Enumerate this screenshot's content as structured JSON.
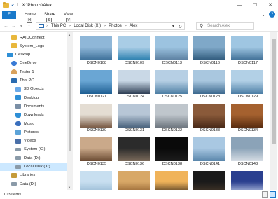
{
  "titlebar": {
    "title": "X:\\Photos\\Alex",
    "sep": "|",
    "minimize": "—",
    "maximize": "☐",
    "close": "✕"
  },
  "ribbon": {
    "file": "F",
    "tabs": [
      {
        "label": "Home",
        "keytip": "H"
      },
      {
        "label": "Share",
        "keytip": "S"
      },
      {
        "label": "View",
        "keytip": "V"
      }
    ],
    "help": "?"
  },
  "address": {
    "back": "←",
    "forward": "→",
    "recent": "▾",
    "up": "↑",
    "crumbs": [
      "This PC",
      "Local Disk (X:)",
      "Photos",
      "Alex"
    ],
    "crumb_sep": ">",
    "refresh": "↻",
    "dropdown": "▾"
  },
  "search": {
    "placeholder": "Search Alex"
  },
  "sidebar": {
    "items": [
      {
        "label": "RAIDConnect",
        "icon": "folder-icon",
        "indent": 2,
        "selected": false
      },
      {
        "label": "System_Logs",
        "icon": "folder-icon",
        "indent": 2,
        "selected": false
      },
      {
        "label": "Desktop",
        "icon": "desktop-icon",
        "indent": 1,
        "selected": false
      },
      {
        "label": "OneDrive",
        "icon": "onedrive-icon",
        "indent": 2,
        "selected": false
      },
      {
        "label": "Tester 1",
        "icon": "user-icon",
        "indent": 2,
        "selected": false
      },
      {
        "label": "This PC",
        "icon": "pc-icon",
        "indent": 2,
        "selected": false
      },
      {
        "label": "3D Objects",
        "icon": "cube-icon",
        "indent": 3,
        "selected": false
      },
      {
        "label": "Desktop",
        "icon": "desktop-icon",
        "indent": 3,
        "selected": false
      },
      {
        "label": "Documents",
        "icon": "documents-icon",
        "indent": 3,
        "selected": false
      },
      {
        "label": "Downloads",
        "icon": "downloads-icon",
        "indent": 3,
        "selected": false
      },
      {
        "label": "Music",
        "icon": "music-icon",
        "indent": 3,
        "selected": false
      },
      {
        "label": "Pictures",
        "icon": "pictures-icon",
        "indent": 3,
        "selected": false
      },
      {
        "label": "Videos",
        "icon": "videos-icon",
        "indent": 3,
        "selected": false
      },
      {
        "label": "System (C:)",
        "icon": "drive-icon",
        "indent": 3,
        "selected": false
      },
      {
        "label": "Data (D:)",
        "icon": "drive-icon",
        "indent": 3,
        "selected": false
      },
      {
        "label": "Local Disk (X:)",
        "icon": "drive-icon",
        "indent": 3,
        "selected": true
      },
      {
        "label": "Libraries",
        "icon": "libraries-icon",
        "indent": 2,
        "selected": false
      },
      {
        "label": "Data (D:)",
        "icon": "drive-icon",
        "indent": 2,
        "selected": false
      }
    ]
  },
  "files": [
    {
      "name": "DSCN0108",
      "top": "#8fb7d8",
      "bottom": "#3c6f98"
    },
    {
      "name": "DSCN0109",
      "top": "#a9cde6",
      "bottom": "#2a7fae"
    },
    {
      "name": "DSCN0113",
      "top": "#9cc3e0",
      "bottom": "#5b7fa0"
    },
    {
      "name": "DSCN0116",
      "top": "#7fa8c8",
      "bottom": "#2f5a7c"
    },
    {
      "name": "DSCN0117",
      "top": "#9fc6e2",
      "bottom": "#3f6f96"
    },
    {
      "name": "DSCN0121",
      "top": "#6aa6d4",
      "bottom": "#1f5f93"
    },
    {
      "name": "DSCN0124",
      "top": "#c9d8e6",
      "bottom": "#2f3f55"
    },
    {
      "name": "DSCN0125",
      "top": "#b6cfe4",
      "bottom": "#4e7fa4"
    },
    {
      "name": "DSCN0128",
      "top": "#a9c7df",
      "bottom": "#3d6a8f"
    },
    {
      "name": "DSCN0129",
      "top": "#b2d0e6",
      "bottom": "#4c7ea5"
    },
    {
      "name": "DSCN0130",
      "top": "#e4ddd3",
      "bottom": "#7a5a45"
    },
    {
      "name": "DSCN0131",
      "top": "#b7c6d6",
      "bottom": "#4b647e"
    },
    {
      "name": "DSCN0132",
      "top": "#bfc6cc",
      "bottom": "#6f7780"
    },
    {
      "name": "DSCN0133",
      "top": "#8a5a3a",
      "bottom": "#4a2a18"
    },
    {
      "name": "DSCN0134",
      "top": "#a5612f",
      "bottom": "#5a2d10"
    },
    {
      "name": "DSCN0135",
      "top": "#caa98a",
      "bottom": "#6a4a32"
    },
    {
      "name": "DSCN0136",
      "top": "#2b2b2b",
      "bottom": "#7a6a5a"
    },
    {
      "name": "DSCN0138",
      "top": "#0a0a0a",
      "bottom": "#1c1c1c"
    },
    {
      "name": "DSCN0141",
      "top": "#a9c8e2",
      "bottom": "#5a86ab"
    },
    {
      "name": "DSCN0143",
      "top": "#8ba3b8",
      "bottom": "#d6dde4"
    },
    {
      "name": "",
      "top": "#c8dff0",
      "bottom": "#8fb3cf"
    },
    {
      "name": "",
      "top": "#d8a867",
      "bottom": "#8a5a2a"
    },
    {
      "name": "",
      "top": "#f0b35a",
      "bottom": "#3a2a1a"
    },
    {
      "name": "",
      "top": "#1a1a1a",
      "bottom": "#4a3a2a"
    },
    {
      "name": "",
      "top": "#2a3f8f",
      "bottom": "#c8d4ec"
    }
  ],
  "status": {
    "count": "103 items"
  },
  "colors": {
    "accent": "#1979ca",
    "selection": "#cce8ff"
  }
}
